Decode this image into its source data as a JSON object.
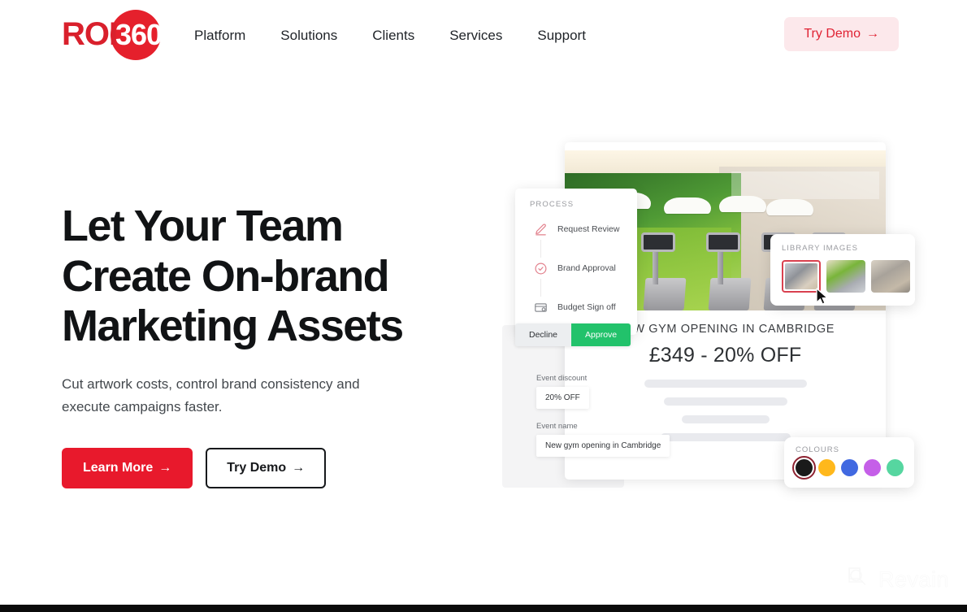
{
  "brand": {
    "logo_primary": "ROI",
    "logo_secondary": "360",
    "red": "#E5202C"
  },
  "nav": {
    "items": [
      {
        "label": "Platform"
      },
      {
        "label": "Solutions"
      },
      {
        "label": "Clients"
      },
      {
        "label": "Services"
      },
      {
        "label": "Support"
      }
    ],
    "demo_button": "Try Demo",
    "demo_arrow": "→"
  },
  "hero": {
    "headline_line1": "Let Your Team",
    "headline_line2": "Create On-brand",
    "headline_line3": "Marketing Assets",
    "subhead": "Cut artwork costs, control brand consistency and execute campaigns faster.",
    "cta_primary": "Learn More",
    "cta_secondary": "Try Demo",
    "arrow": "→"
  },
  "mockup": {
    "process": {
      "label": "PROCESS",
      "steps": [
        {
          "label": "Request Review",
          "icon": "pencil-icon",
          "color": "#E2808C"
        },
        {
          "label": "Brand Approval",
          "icon": "check-circle-icon",
          "color": "#E2808C"
        },
        {
          "label": "Budget Sign off",
          "icon": "budget-card-icon",
          "color": "#8B8E93"
        }
      ],
      "decline": "Decline",
      "approve": "Approve",
      "approve_color": "#22C26B"
    },
    "ad": {
      "title": "NEW GYM OPENING IN CAMBRIDGE",
      "price": "£349 - 20% OFF"
    },
    "form": {
      "discount_label": "Event discount",
      "discount_value": "20% OFF",
      "name_label": "Event name",
      "name_value": "New gym opening in Cambridge"
    },
    "library": {
      "label": "LIBRARY IMAGES",
      "thumbs": [
        {
          "name": "gym-thumb-1",
          "selected": true
        },
        {
          "name": "gym-thumb-2",
          "selected": false
        },
        {
          "name": "gym-thumb-3",
          "selected": false
        }
      ]
    },
    "colours": {
      "label": "COLOURS",
      "swatches": [
        {
          "name": "black",
          "hex": "#1A1A1A",
          "selected": true
        },
        {
          "name": "amber",
          "hex": "#FFB81C",
          "selected": false
        },
        {
          "name": "blue",
          "hex": "#4169E1",
          "selected": false
        },
        {
          "name": "purple",
          "hex": "#C55FE8",
          "selected": false
        },
        {
          "name": "mint",
          "hex": "#56D6A0",
          "selected": false
        }
      ]
    }
  },
  "watermark": {
    "text": "Revain"
  }
}
